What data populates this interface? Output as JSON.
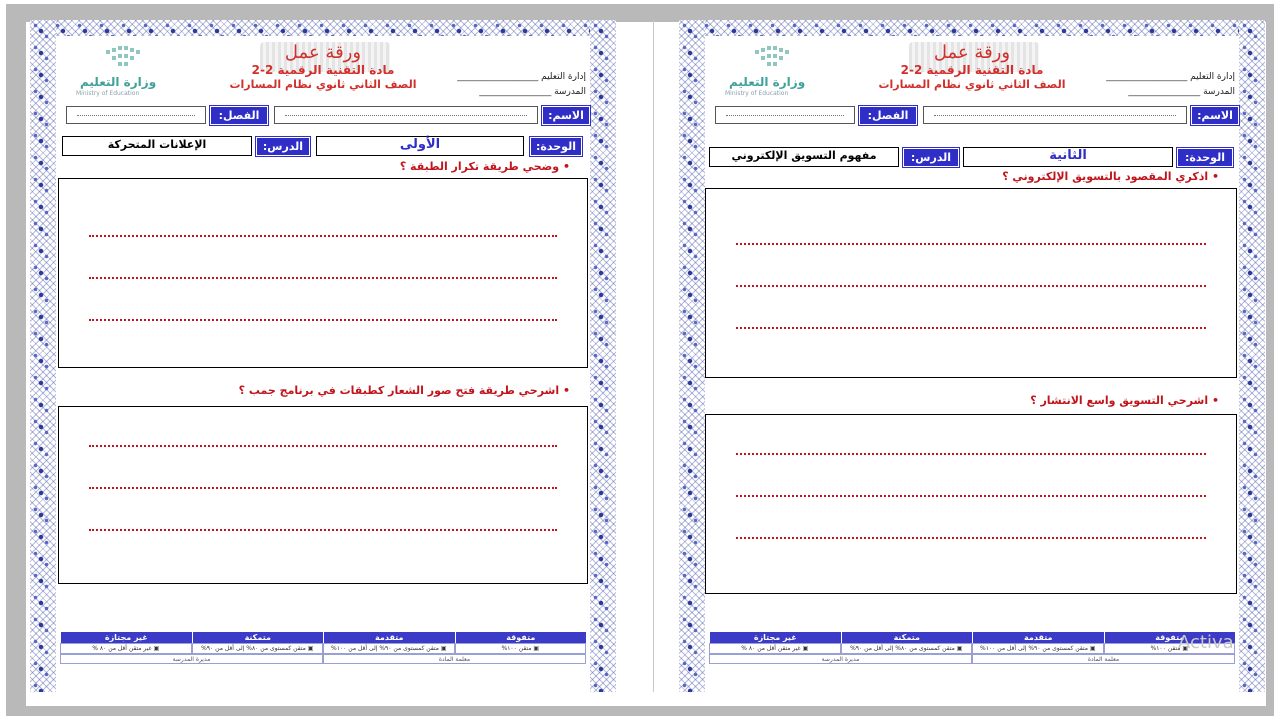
{
  "worksheets": [
    {
      "title": "ورقة عمل",
      "subject": "مادة التقنية الرقمية 2-2",
      "grade": "الصف الثاني ثانوي نظام المسارات",
      "admin_label": "إدارة التعليم",
      "admin_dots": "__________________",
      "school_label": "المدرسة",
      "school_dots": "________________",
      "ministry_ar": "وزارة التعليم",
      "ministry_en": "Ministry of Education",
      "name_label": "الاسم:",
      "class_label": "الفصل:",
      "unit_label": "الوحدة:",
      "unit_value": "الأولى",
      "lesson_label": "الدرس:",
      "lesson_value": "الإعلانات المتحركة",
      "question1": "•  وضحي  طريقة تكرار الطبقة ؟",
      "question2": "•  اشرحي   طريقة فتح صور الشعار كطبقات في برنامج جمب ؟",
      "grades": {
        "headers": [
          "متفوقة",
          "متقدمة",
          "متمكنة",
          "غير مجتازة"
        ],
        "criteria": [
          "▣ متقن ١٠٠%",
          "▣ متقن كمستوى من ٩٠% إلى أقل من ١٠٠%",
          "▣ متقن كمستوى من ٨٠% إلى أقل من ٩٠%",
          "▣ غير متقن أقل من ٨٠ %"
        ],
        "footer": [
          "معلمة المادة",
          "مديرة المدرسة"
        ]
      }
    },
    {
      "title": "ورقة عمل",
      "subject": "مادة التقنية الرقمية 2-2",
      "grade": "الصف الثاني ثانوي نظام المسارات",
      "admin_label": "إدارة التعليم",
      "admin_dots": "__________________",
      "school_label": "المدرسة",
      "school_dots": "________________",
      "ministry_ar": "وزارة التعليم",
      "ministry_en": "Ministry of Education",
      "name_label": "الاسم:",
      "class_label": "الفصل:",
      "unit_label": "الوحدة:",
      "unit_value": "الثانية",
      "lesson_label": "الدرس:",
      "lesson_value": "مفهوم التسويق الإلكتروني",
      "question1": "•  اذكري  المقصود بالتسويق الإلكتروني ؟",
      "question2": "•  اشرحي   التسويق واسع الانتشار ؟",
      "grades": {
        "headers": [
          "متفوقة",
          "متقدمة",
          "متمكنة",
          "غير مجتازة"
        ],
        "criteria": [
          "▣ متقن ١٠٠%",
          "▣ متقن كمستوى من ٩٠% إلى أقل من ١٠٠%",
          "▣ متقن كمستوى من ٨٠% إلى أقل من ٩٠%",
          "▣ غير متقن أقل من ٨٠ %"
        ],
        "footer": [
          "معلمة المادة",
          "مديرة المدرسة"
        ]
      }
    }
  ],
  "watermark": "Activa"
}
